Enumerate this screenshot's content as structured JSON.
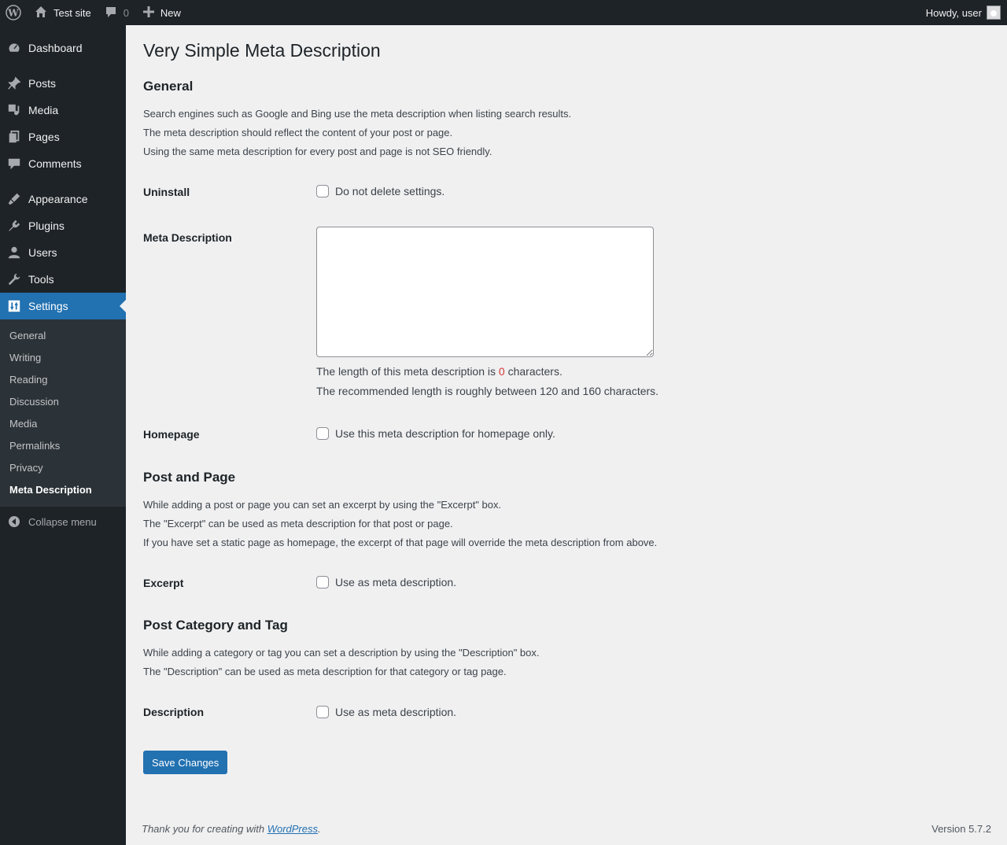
{
  "adminbar": {
    "site_name": "Test site",
    "comments_count": "0",
    "new_label": "New",
    "howdy": "Howdy, user"
  },
  "sidebar": {
    "items": [
      {
        "label": "Dashboard",
        "icon": "dashboard-icon"
      },
      {
        "label": "Posts",
        "icon": "pin-icon"
      },
      {
        "label": "Media",
        "icon": "media-icon"
      },
      {
        "label": "Pages",
        "icon": "pages-icon"
      },
      {
        "label": "Comments",
        "icon": "comment-icon"
      },
      {
        "label": "Appearance",
        "icon": "brush-icon"
      },
      {
        "label": "Plugins",
        "icon": "plug-icon"
      },
      {
        "label": "Users",
        "icon": "user-icon"
      },
      {
        "label": "Tools",
        "icon": "wrench-icon"
      },
      {
        "label": "Settings",
        "icon": "settings-icon"
      }
    ],
    "submenu": [
      "General",
      "Writing",
      "Reading",
      "Discussion",
      "Media",
      "Permalinks",
      "Privacy",
      "Meta Description"
    ],
    "collapse_label": "Collapse menu"
  },
  "page": {
    "title": "Very Simple Meta Description",
    "general": {
      "heading": "General",
      "lines": [
        "Search engines such as Google and Bing use the meta description when listing search results.",
        "The meta description should reflect the content of your post or page.",
        "Using the same meta description for every post and page is not SEO friendly."
      ],
      "uninstall_label": "Uninstall",
      "uninstall_option": "Do not delete settings.",
      "meta_label": "Meta Description",
      "meta_value": "",
      "length_prefix": "The length of this meta description is ",
      "length_count": "0",
      "length_suffix": " characters.",
      "recommended": "The recommended length is roughly between 120 and 160 characters.",
      "homepage_label": "Homepage",
      "homepage_option": "Use this meta description for homepage only."
    },
    "post_page": {
      "heading": "Post and Page",
      "lines": [
        "While adding a post or page you can set an excerpt by using the \"Excerpt\" box.",
        "The \"Excerpt\" can be used as meta description for that post or page.",
        "If you have set a static page as homepage, the excerpt of that page will override the meta description from above."
      ],
      "excerpt_label": "Excerpt",
      "excerpt_option": "Use as meta description."
    },
    "category_tag": {
      "heading": "Post Category and Tag",
      "lines": [
        "While adding a category or tag you can set a description by using the \"Description\" box.",
        "The \"Description\" can be used as meta description for that category or tag page."
      ],
      "description_label": "Description",
      "description_option": "Use as meta description."
    },
    "save_label": "Save Changes"
  },
  "footer": {
    "thanks_prefix": "Thank you for creating with ",
    "link": "WordPress",
    "thanks_suffix": ".",
    "version": "Version 5.7.2"
  }
}
